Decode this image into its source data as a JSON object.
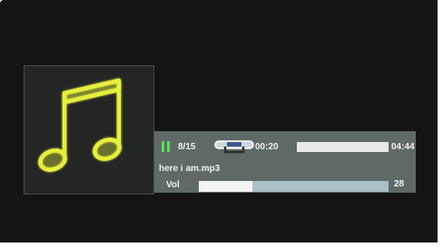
{
  "player": {
    "state_icon": "pause-icon",
    "track_index": "8/15",
    "repeat_icon": "repeat-icon",
    "elapsed": "00:20",
    "duration": "04:44",
    "progress_fraction": 0.0,
    "filename": "here i am.mp3",
    "volume_label": "Vol",
    "volume_value": "28",
    "volume_fraction": 0.28,
    "album_art_icon": "music-note-icon"
  },
  "colors": {
    "background": "#141414",
    "panel": "#5f6a68",
    "accent_green": "#57e05a",
    "note_yellow": "#e6f03a",
    "volume_track": "#a9c2c6"
  }
}
